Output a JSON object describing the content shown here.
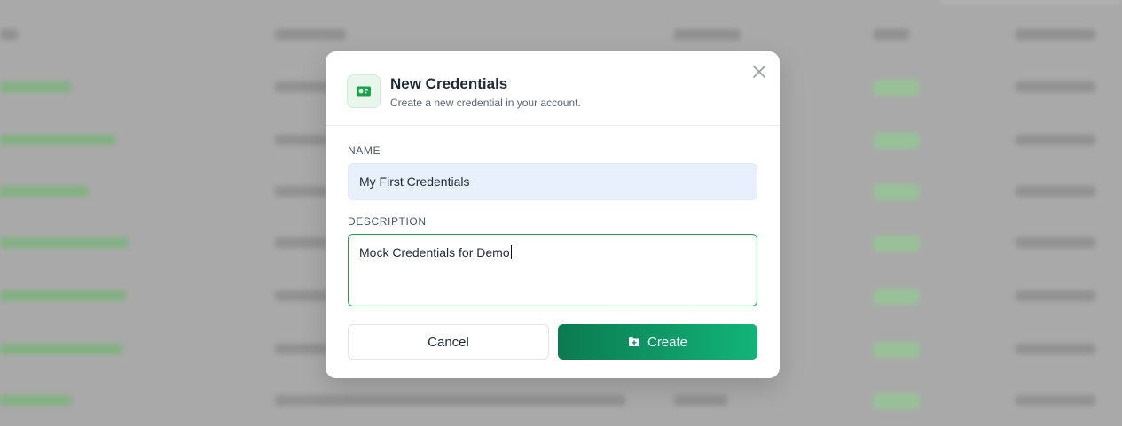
{
  "modal": {
    "title": "New Credentials",
    "subtitle": "Create a new credential in your account.",
    "header_icon": "credential-card-icon",
    "close_icon": "close-icon",
    "accent_color": "#16a34a"
  },
  "form": {
    "name_label": "NAME",
    "name_value": "My First Credentials",
    "description_label": "DESCRIPTION",
    "description_value": "Mock Credentials for Demo"
  },
  "actions": {
    "cancel_label": "Cancel",
    "create_label": "Create",
    "create_icon": "folder-plus-icon",
    "create_gradient": [
      "#0b7a50",
      "#12b47a"
    ]
  }
}
